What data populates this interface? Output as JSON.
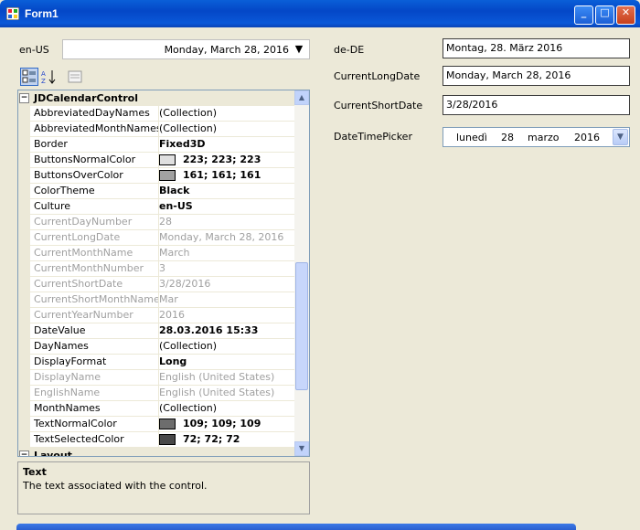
{
  "window": {
    "title": "Form1",
    "min_glyph": "_",
    "max_glyph": "□",
    "close_glyph": "✕"
  },
  "left": {
    "culture_label": "en-US",
    "culture_combo_value": "Monday, March 28, 2016",
    "combo_arrow": "▼"
  },
  "grid": {
    "category1": "JDCalendarControl",
    "category2": "Layout",
    "rows": [
      {
        "name": "AbbreviatedDayNames",
        "value": "(Collection)",
        "bold": false,
        "ro": false
      },
      {
        "name": "AbbreviatedMonthNames",
        "value": "(Collection)",
        "bold": false,
        "ro": false
      },
      {
        "name": "Border",
        "value": "Fixed3D",
        "bold": true,
        "ro": false
      },
      {
        "name": "ButtonsNormalColor",
        "value": "223; 223; 223",
        "bold": true,
        "ro": false,
        "swatch": "#dfdfdf"
      },
      {
        "name": "ButtonsOverColor",
        "value": "161; 161; 161",
        "bold": true,
        "ro": false,
        "swatch": "#a1a1a1"
      },
      {
        "name": "ColorTheme",
        "value": "Black",
        "bold": true,
        "ro": false
      },
      {
        "name": "Culture",
        "value": "en-US",
        "bold": true,
        "ro": false
      },
      {
        "name": "CurrentDayNumber",
        "value": "28",
        "bold": false,
        "ro": true
      },
      {
        "name": "CurrentLongDate",
        "value": "Monday, March 28, 2016",
        "bold": false,
        "ro": true
      },
      {
        "name": "CurrentMonthName",
        "value": "March",
        "bold": false,
        "ro": true
      },
      {
        "name": "CurrentMonthNumber",
        "value": "3",
        "bold": false,
        "ro": true
      },
      {
        "name": "CurrentShortDate",
        "value": "3/28/2016",
        "bold": false,
        "ro": true
      },
      {
        "name": "CurrentShortMonthName",
        "value": "Mar",
        "bold": false,
        "ro": true
      },
      {
        "name": "CurrentYearNumber",
        "value": "2016",
        "bold": false,
        "ro": true
      },
      {
        "name": "DateValue",
        "value": "28.03.2016 15:33",
        "bold": true,
        "ro": false
      },
      {
        "name": "DayNames",
        "value": "(Collection)",
        "bold": false,
        "ro": false
      },
      {
        "name": "DisplayFormat",
        "value": "Long",
        "bold": true,
        "ro": false
      },
      {
        "name": "DisplayName",
        "value": "English (United States)",
        "bold": false,
        "ro": true
      },
      {
        "name": "EnglishName",
        "value": "English (United States)",
        "bold": false,
        "ro": true
      },
      {
        "name": "MonthNames",
        "value": "(Collection)",
        "bold": false,
        "ro": false
      },
      {
        "name": "TextNormalColor",
        "value": "109; 109; 109",
        "bold": true,
        "ro": false,
        "swatch": "#6d6d6d"
      },
      {
        "name": "TextSelectedColor",
        "value": "72; 72; 72",
        "bold": true,
        "ro": false,
        "swatch": "#484848"
      }
    ],
    "help_title": "Text",
    "help_desc": "The text associated with the control."
  },
  "right": {
    "dede_label": "de-DE",
    "dede_value": "Montag, 28. März 2016",
    "longdate_label": "CurrentLongDate",
    "longdate_value": "Monday, March 28, 2016",
    "shortdate_label": "CurrentShortDate",
    "shortdate_value": "3/28/2016",
    "dtp_label": "DateTimePicker",
    "dtp_day": "lunedì",
    "dtp_date": "28",
    "dtp_month": "marzo",
    "dtp_year": "2016"
  },
  "colors": {
    "titlebar": "#0a5fd8",
    "face": "#ece9d8",
    "close": "#c7401c"
  }
}
